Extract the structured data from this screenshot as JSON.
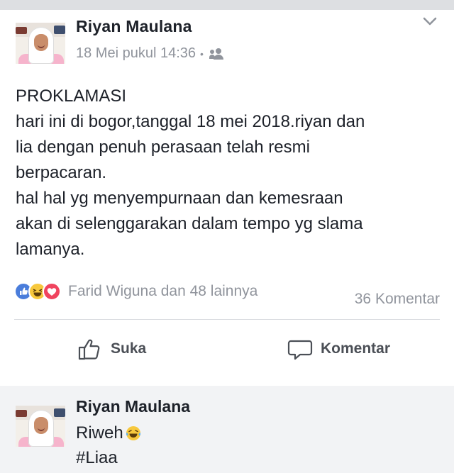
{
  "post": {
    "author": "Riyan Maulana",
    "timestamp": "18 Mei pukul 14:36",
    "dot": "•",
    "audience_icon": "friends-icon",
    "body_lines": [
      "PROKLAMASI",
      "hari ini di bogor,tanggal 18 mei 2018.riyan dan",
      "lia dengan penuh perasaan telah resmi",
      "berpacaran.",
      "hal hal yg menyempurnaan dan kemesraan",
      "akan di selenggarakan dalam tempo yg slama",
      "lamanya."
    ],
    "reactions": {
      "icons": [
        "like-reaction-icon",
        "haha-reaction-icon",
        "love-reaction-icon"
      ],
      "text": "Farid Wiguna dan 48 lainnya",
      "comments": "36 Komentar"
    },
    "actions": {
      "like_label": "Suka",
      "comment_label": "Komentar"
    }
  },
  "comment": {
    "author": "Riyan Maulana",
    "line1": "Riweh",
    "line1_emoji": "laughing-tears-emoji",
    "line2": "#Liaa"
  },
  "colors": {
    "text": "#1d2129",
    "meta": "#90949c",
    "like_blue": "#4a7ddb",
    "haha_yellow": "#f7c83d",
    "love_red": "#f0445f",
    "band": "#f2f3f5"
  }
}
